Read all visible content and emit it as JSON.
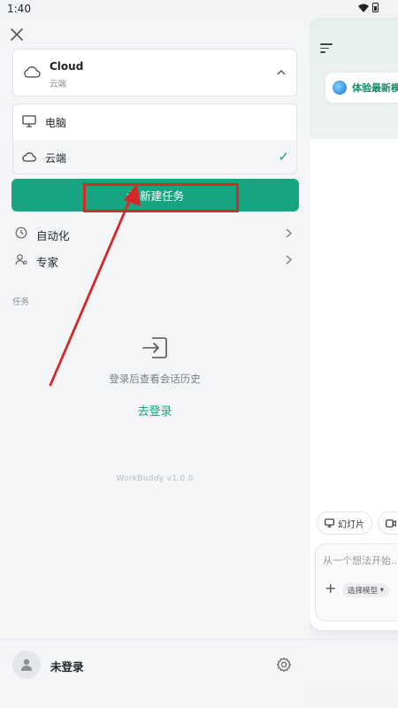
{
  "status_bar": {
    "time": "1:40"
  },
  "drawer": {
    "environment": {
      "selected_title": "Cloud",
      "selected_subtitle": "云端",
      "options": [
        {
          "label": "电脑",
          "icon": "monitor-icon"
        },
        {
          "label": "云端",
          "icon": "cloud-icon",
          "checked": true
        }
      ]
    },
    "new_task_label": "新建任务",
    "nav_items": [
      {
        "label": "自动化",
        "icon": "clock-icon"
      },
      {
        "label": "专家",
        "icon": "user-star-icon"
      }
    ],
    "section_label": "任务",
    "empty_state": {
      "message": "登录后查看会话历史",
      "login_link": "去登录"
    },
    "version": "WorkBuddy v1.0.0",
    "profile": {
      "name": "未登录"
    }
  },
  "main_preview": {
    "promo_text": "体验最新模",
    "quick_chips": [
      "幻灯片",
      "视"
    ],
    "input_placeholder": "从一个想法开始...",
    "model_select": "选择模型"
  },
  "colors": {
    "accent": "#17a480",
    "annotation": "#d62828"
  }
}
